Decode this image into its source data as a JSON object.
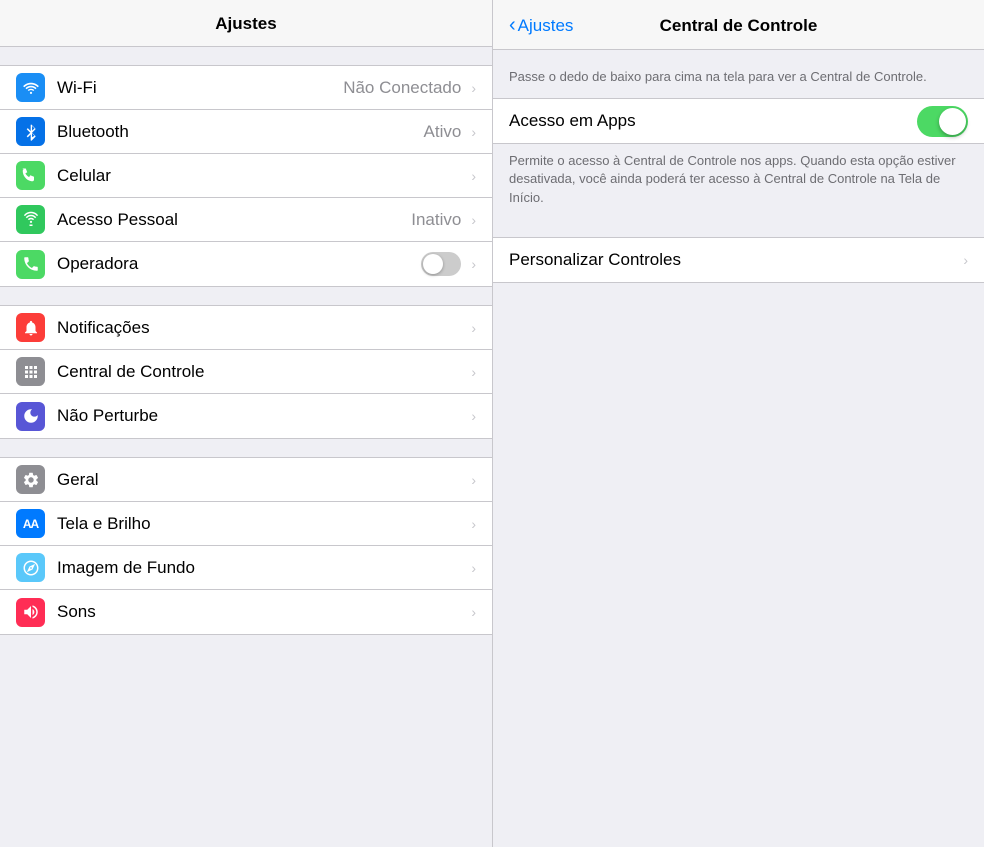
{
  "left": {
    "header": {
      "title": "Ajustes"
    },
    "sections": [
      {
        "items": [
          {
            "id": "wifi",
            "label": "Wi-Fi",
            "value": "Não Conectado",
            "icon": "wifi",
            "bg": "bg-blue",
            "hasChevron": true
          },
          {
            "id": "bluetooth",
            "label": "Bluetooth",
            "value": "Ativo",
            "icon": "bluetooth",
            "bg": "bg-blue2",
            "hasChevron": true
          },
          {
            "id": "celular",
            "label": "Celular",
            "value": "",
            "icon": "cellular",
            "bg": "bg-green",
            "hasChevron": true
          },
          {
            "id": "acesso-pessoal",
            "label": "Acesso Pessoal",
            "value": "Inativo",
            "icon": "hotspot",
            "bg": "bg-green2",
            "hasChevron": true
          },
          {
            "id": "operadora",
            "label": "Operadora",
            "value": "",
            "icon": "phone",
            "bg": "bg-green",
            "hasChevron": true,
            "hasToggle": true
          }
        ]
      },
      {
        "items": [
          {
            "id": "notificacoes",
            "label": "Notificações",
            "value": "",
            "icon": "bell",
            "bg": "bg-red",
            "hasChevron": true
          },
          {
            "id": "central-controle",
            "label": "Central de Controle",
            "value": "",
            "icon": "switches",
            "bg": "bg-gray",
            "hasChevron": true
          },
          {
            "id": "nao-perturbe",
            "label": "Não Perturbe",
            "value": "",
            "icon": "moon",
            "bg": "bg-purple",
            "hasChevron": true
          }
        ]
      },
      {
        "items": [
          {
            "id": "geral",
            "label": "Geral",
            "value": "",
            "icon": "gear",
            "bg": "bg-gray",
            "hasChevron": true
          },
          {
            "id": "tela-brilho",
            "label": "Tela e Brilho",
            "value": "",
            "icon": "AA",
            "bg": "bg-blue3",
            "hasChevron": true
          },
          {
            "id": "imagem-fundo",
            "label": "Imagem de Fundo",
            "value": "",
            "icon": "flower",
            "bg": "bg-teal",
            "hasChevron": true
          },
          {
            "id": "sons",
            "label": "Sons",
            "value": "",
            "icon": "speaker",
            "bg": "bg-pink",
            "hasChevron": true
          }
        ]
      }
    ]
  },
  "right": {
    "header": {
      "back_label": "Ajustes",
      "title": "Central de Controle"
    },
    "description": "Passe o dedo de baixo para cima na tela para ver a Central de Controle.",
    "toggle_row": {
      "label": "Acesso em Apps",
      "enabled": true
    },
    "toggle_description": "Permite o acesso à Central de Controle nos apps. Quando esta opção estiver desativada, você ainda poderá ter acesso à Central de Controle na Tela de Início.",
    "personalizar": {
      "label": "Personalizar Controles"
    }
  }
}
